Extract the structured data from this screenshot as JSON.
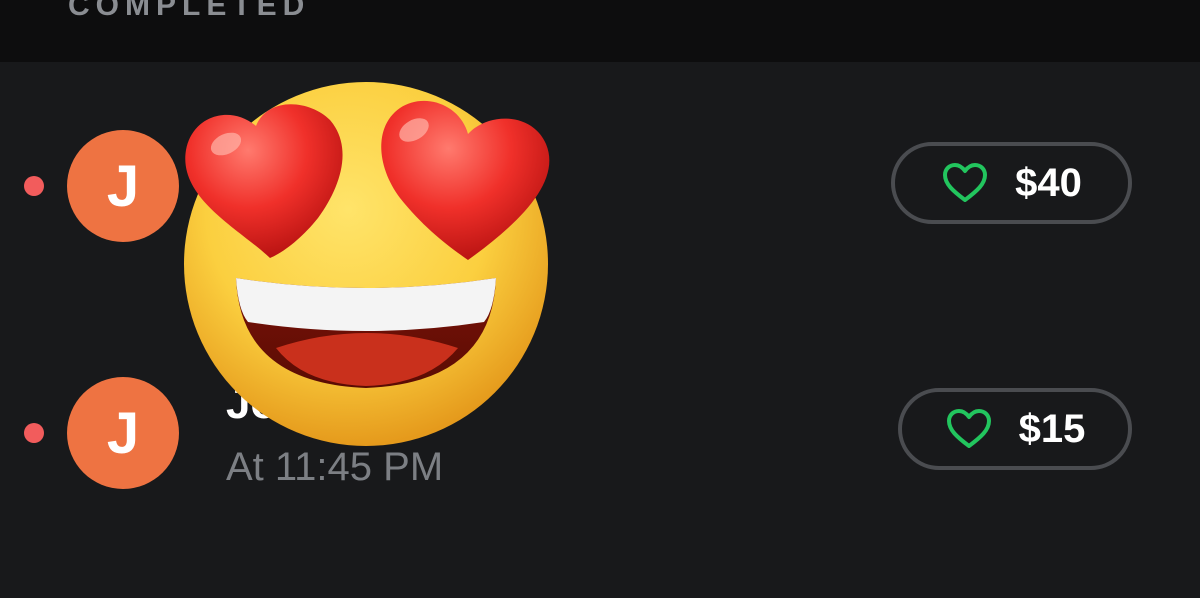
{
  "header": {
    "section_title": "COMPLETED"
  },
  "rows": [
    {
      "avatar_initial": "J",
      "name": "",
      "time": "",
      "amount": "$40",
      "unread": true
    },
    {
      "avatar_initial": "J",
      "name": "Jo     s",
      "time": "At 11:45 PM",
      "amount": "$15",
      "unread": true
    }
  ],
  "overlay": {
    "emoji": "smiling-face-with-heart-eyes"
  },
  "colors": {
    "background": "#18191b",
    "header_background": "#0d0d0e",
    "avatar": "#ee7342",
    "unread_dot": "#f25c5c",
    "heart": "#22c55e",
    "button_border": "#4a4c50",
    "secondary_text": "#7c7f84"
  }
}
